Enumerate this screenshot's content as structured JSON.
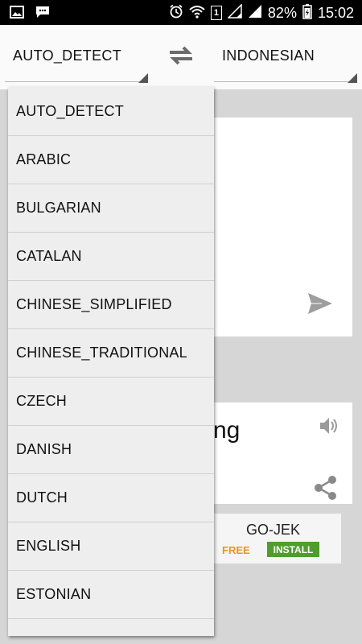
{
  "status_bar": {
    "sim_label": "1",
    "battery": "82%",
    "time": "15:02",
    "icons": [
      "image-icon",
      "message-icon",
      "alarm-icon",
      "wifi-icon",
      "signal-icon",
      "signal-icon",
      "battery-icon"
    ]
  },
  "header": {
    "source_language": "AUTO_DETECT",
    "target_language": "INDONESIAN",
    "swap_icon": "swap-arrows-icon"
  },
  "translation": {
    "output_partial_text": "ng",
    "send_icon": "send-icon",
    "speaker_icon": "speaker-icon",
    "share_icon": "share-icon"
  },
  "ad": {
    "title": "GO-JEK",
    "price": "FREE",
    "install_label": "INSTALL",
    "free_color": "#e8961a",
    "install_color": "#4e9d2d"
  },
  "dropdown": {
    "items": [
      "AUTO_DETECT",
      "ARABIC",
      "BULGARIAN",
      "CATALAN",
      "CHINESE_SIMPLIFIED",
      "CHINESE_TRADITIONAL",
      "CZECH",
      "DANISH",
      "DUTCH",
      "ENGLISH",
      "ESTONIAN"
    ]
  }
}
